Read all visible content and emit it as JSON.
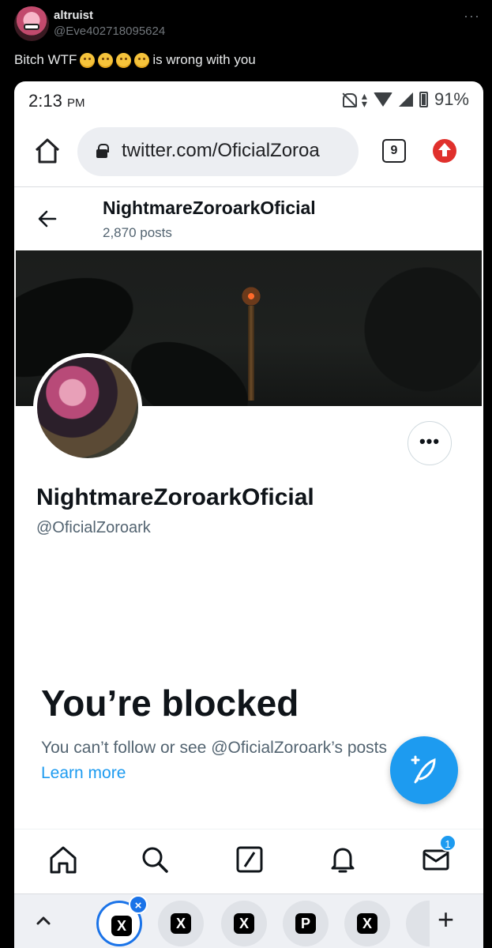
{
  "tweet": {
    "author_name": "altruist",
    "author_handle": "@Eve402718095624",
    "more_glyph": "···",
    "text_start": "Bitch WTF",
    "text_end": "is wrong with you"
  },
  "status_bar": {
    "time": "2:13",
    "ampm": "PM",
    "battery": "91%"
  },
  "browser": {
    "url": "twitter.com/OficialZoroa",
    "tab_count": "9"
  },
  "profile_header": {
    "name": "NightmareZoroarkOficial",
    "posts": "2,870 posts"
  },
  "profile": {
    "name": "NightmareZoroarkOficial",
    "handle": "@OficialZoroark",
    "more_glyph": "•••"
  },
  "blocked": {
    "title": "You’re blocked",
    "text": "You can’t follow or see @OficialZoroark’s posts",
    "learn_more": "Learn more"
  },
  "nav": {
    "messages_badge": "1"
  },
  "chrome_tabs": {
    "tabs": [
      "X",
      "X",
      "X",
      "P",
      "X"
    ],
    "close_glyph": "×",
    "new_tab_glyph": "+"
  }
}
